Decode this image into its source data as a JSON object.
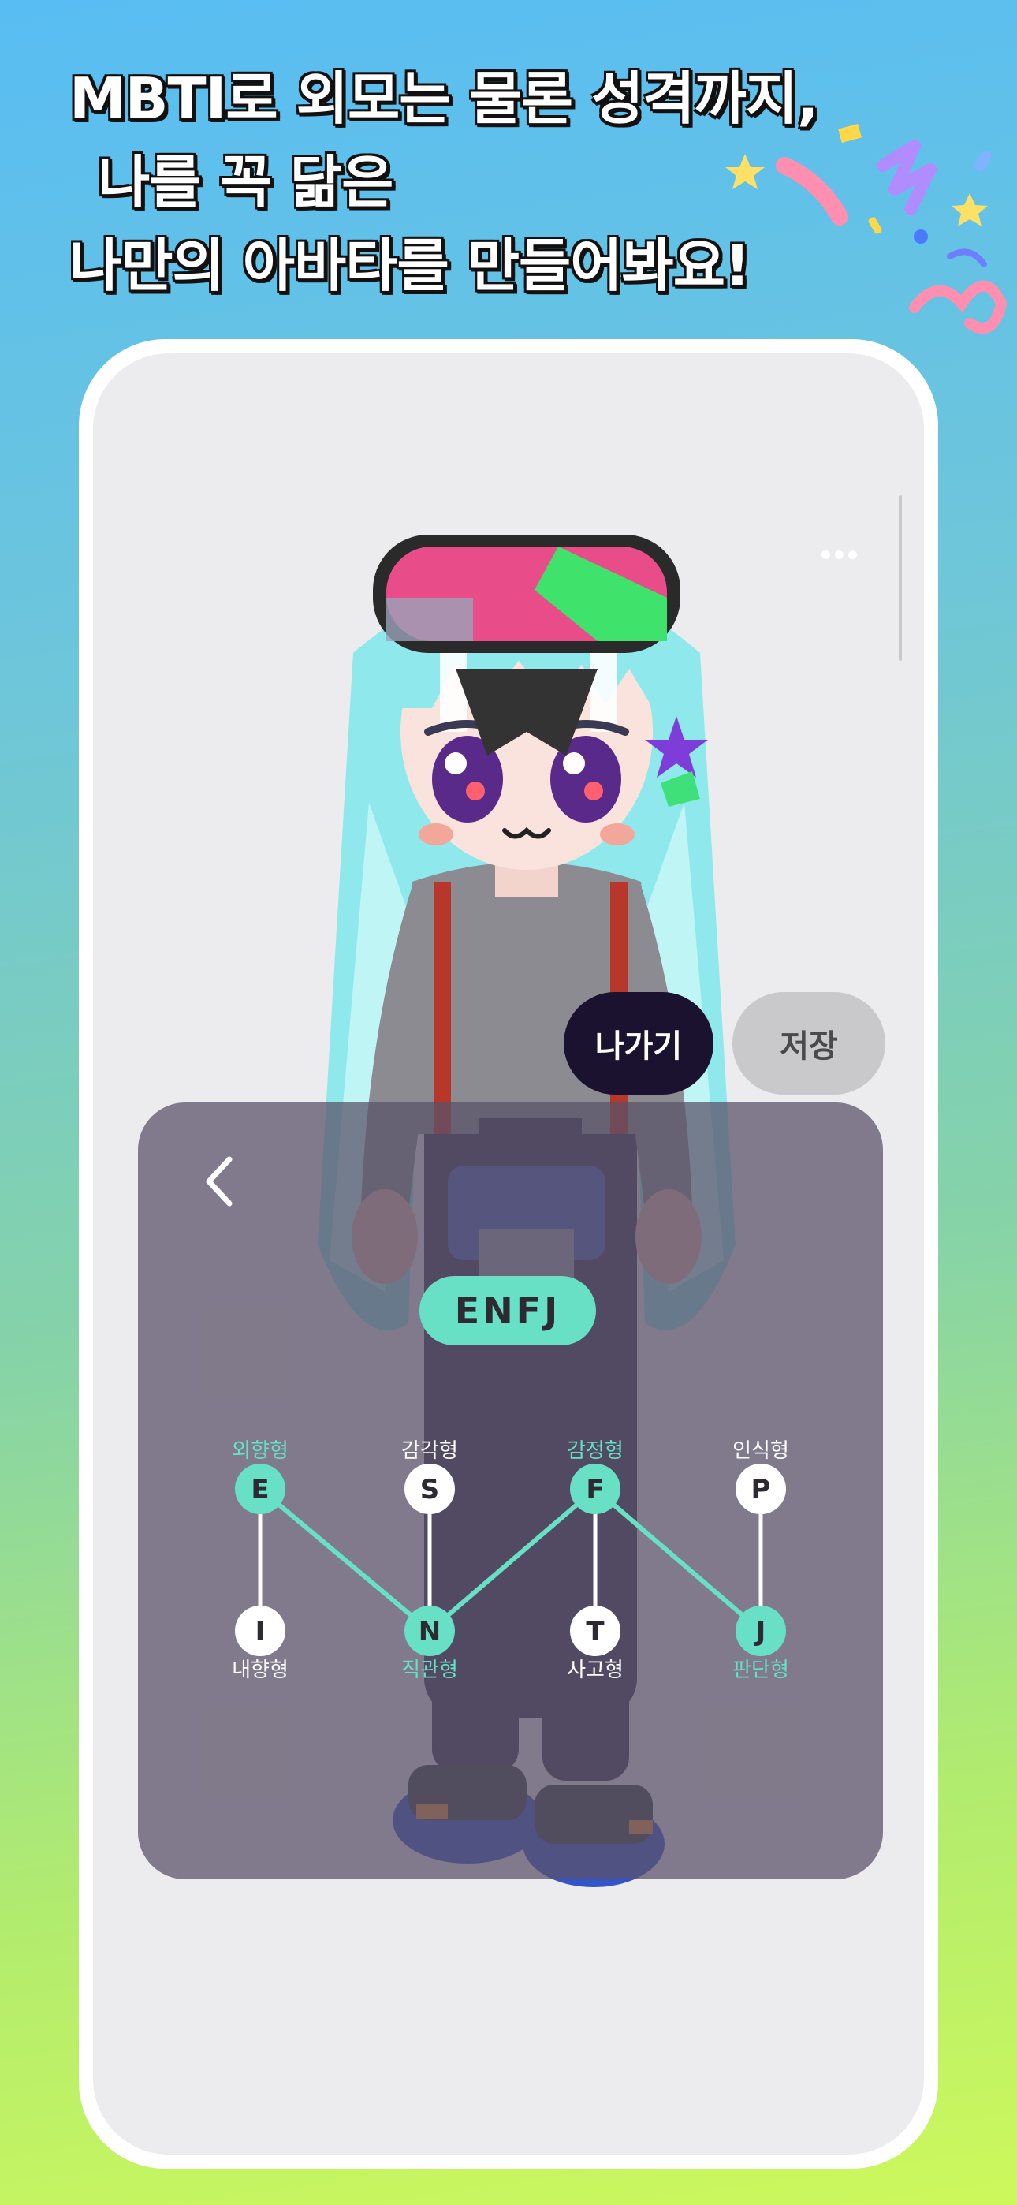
{
  "headline": {
    "line1": "MBTI로 외모는 물론  성격까지,",
    "line2": "나를 꼭 닮은",
    "line3": "나만의 아바타를 만들어봐요!"
  },
  "toolbar": {
    "exit_label": "나가기",
    "save_label": "저장"
  },
  "mbti": {
    "result": "ENFJ",
    "accent": "#67e0c5",
    "axes": [
      {
        "top_letter": "E",
        "top_label": "외향형",
        "bottom_letter": "I",
        "bottom_label": "내향형",
        "selected": "top"
      },
      {
        "top_letter": "S",
        "top_label": "감각형",
        "bottom_letter": "N",
        "bottom_label": "직관형",
        "selected": "bottom"
      },
      {
        "top_letter": "F",
        "top_label": "감정형",
        "bottom_letter": "T",
        "bottom_label": "사고형",
        "selected": "top"
      },
      {
        "top_letter": "P",
        "top_label": "인식형",
        "bottom_letter": "J",
        "bottom_label": "판단형",
        "selected": "bottom"
      }
    ]
  }
}
